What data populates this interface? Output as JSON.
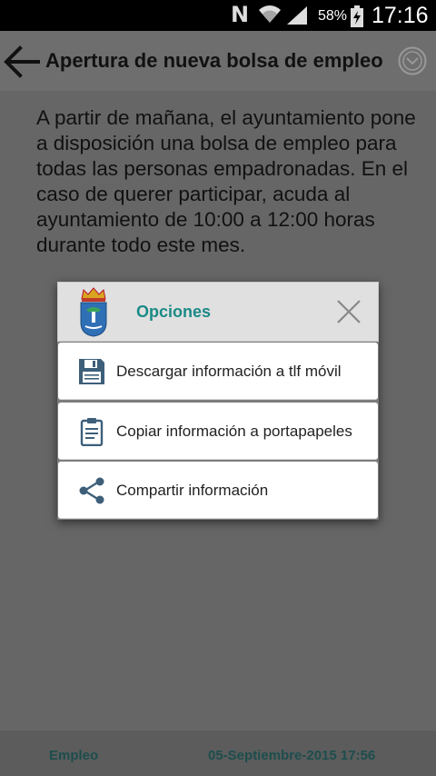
{
  "status_bar": {
    "nfc_glyph": "N",
    "battery_percent": "58%",
    "time": "17:16"
  },
  "app_bar": {
    "title": "Apertura de nueva bolsa de empleo"
  },
  "content": {
    "body": "A partir de mañana, el ayuntamiento pone a disposición una bolsa de empleo para todas las personas empadronadas. En el caso de querer participar, acuda al ayuntamiento de 10:00 a 12:00 horas durante todo este mes."
  },
  "footer": {
    "category": "Empleo",
    "date": "05-Septiembre-2015 17:56"
  },
  "dialog": {
    "title": "Opciones",
    "options": [
      {
        "label": "Descargar información a tlf móvil",
        "icon": "floppy-disk-icon"
      },
      {
        "label": "Copiar información a portapapeles",
        "icon": "clipboard-icon"
      },
      {
        "label": "Compartir información",
        "icon": "share-icon"
      }
    ]
  },
  "colors": {
    "accent": "#1b8a86",
    "icon": "#3d5f7a",
    "overlay": "#666666"
  }
}
